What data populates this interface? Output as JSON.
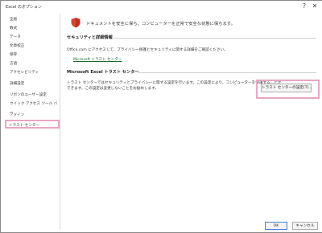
{
  "window": {
    "title": "Excel のオプション",
    "help_glyph": "?",
    "close_glyph": "✕"
  },
  "sidebar": {
    "items": [
      {
        "label": "全般"
      },
      {
        "label": "数式"
      },
      {
        "label": "データ"
      },
      {
        "label": "文章校正"
      },
      {
        "label": "保存"
      },
      {
        "label": "言語"
      },
      {
        "label": "アクセシビリティ"
      },
      {
        "label": "詳細設定"
      },
      {
        "label": "リボンのユーザー設定"
      },
      {
        "label": "クイック アクセス ツール バー"
      },
      {
        "label": "アドイン"
      },
      {
        "label": "トラスト センター"
      }
    ],
    "selected_index": 11
  },
  "main": {
    "header_text": "ドキュメントを安全に保ち、コンピューターを正常で安全な状態に保ちます。",
    "security": {
      "title": "セキュリティと詳細情報",
      "description": "Office.com にアクセスして、プライバシー保護とセキュリティに関する詳細をご確認ください。",
      "link": "Microsoft トラスト センター"
    },
    "trust_center": {
      "title": "Microsoft Excel トラスト センター",
      "description_line1": "トラスト センターではセキュリティとプライバシーに関する設定を行います。この設定により、コンピューターを保護することが",
      "description_line2": "できます。この設定は変更しないことをお勧めします。",
      "settings_button": "トラスト センターの設定(T)..."
    }
  },
  "footer": {
    "ok_label": "OK",
    "cancel_label": "キャンセル"
  },
  "colors": {
    "highlight": "#e9a6c4",
    "shield": "#d9442b",
    "link": "#1a6b2f"
  }
}
